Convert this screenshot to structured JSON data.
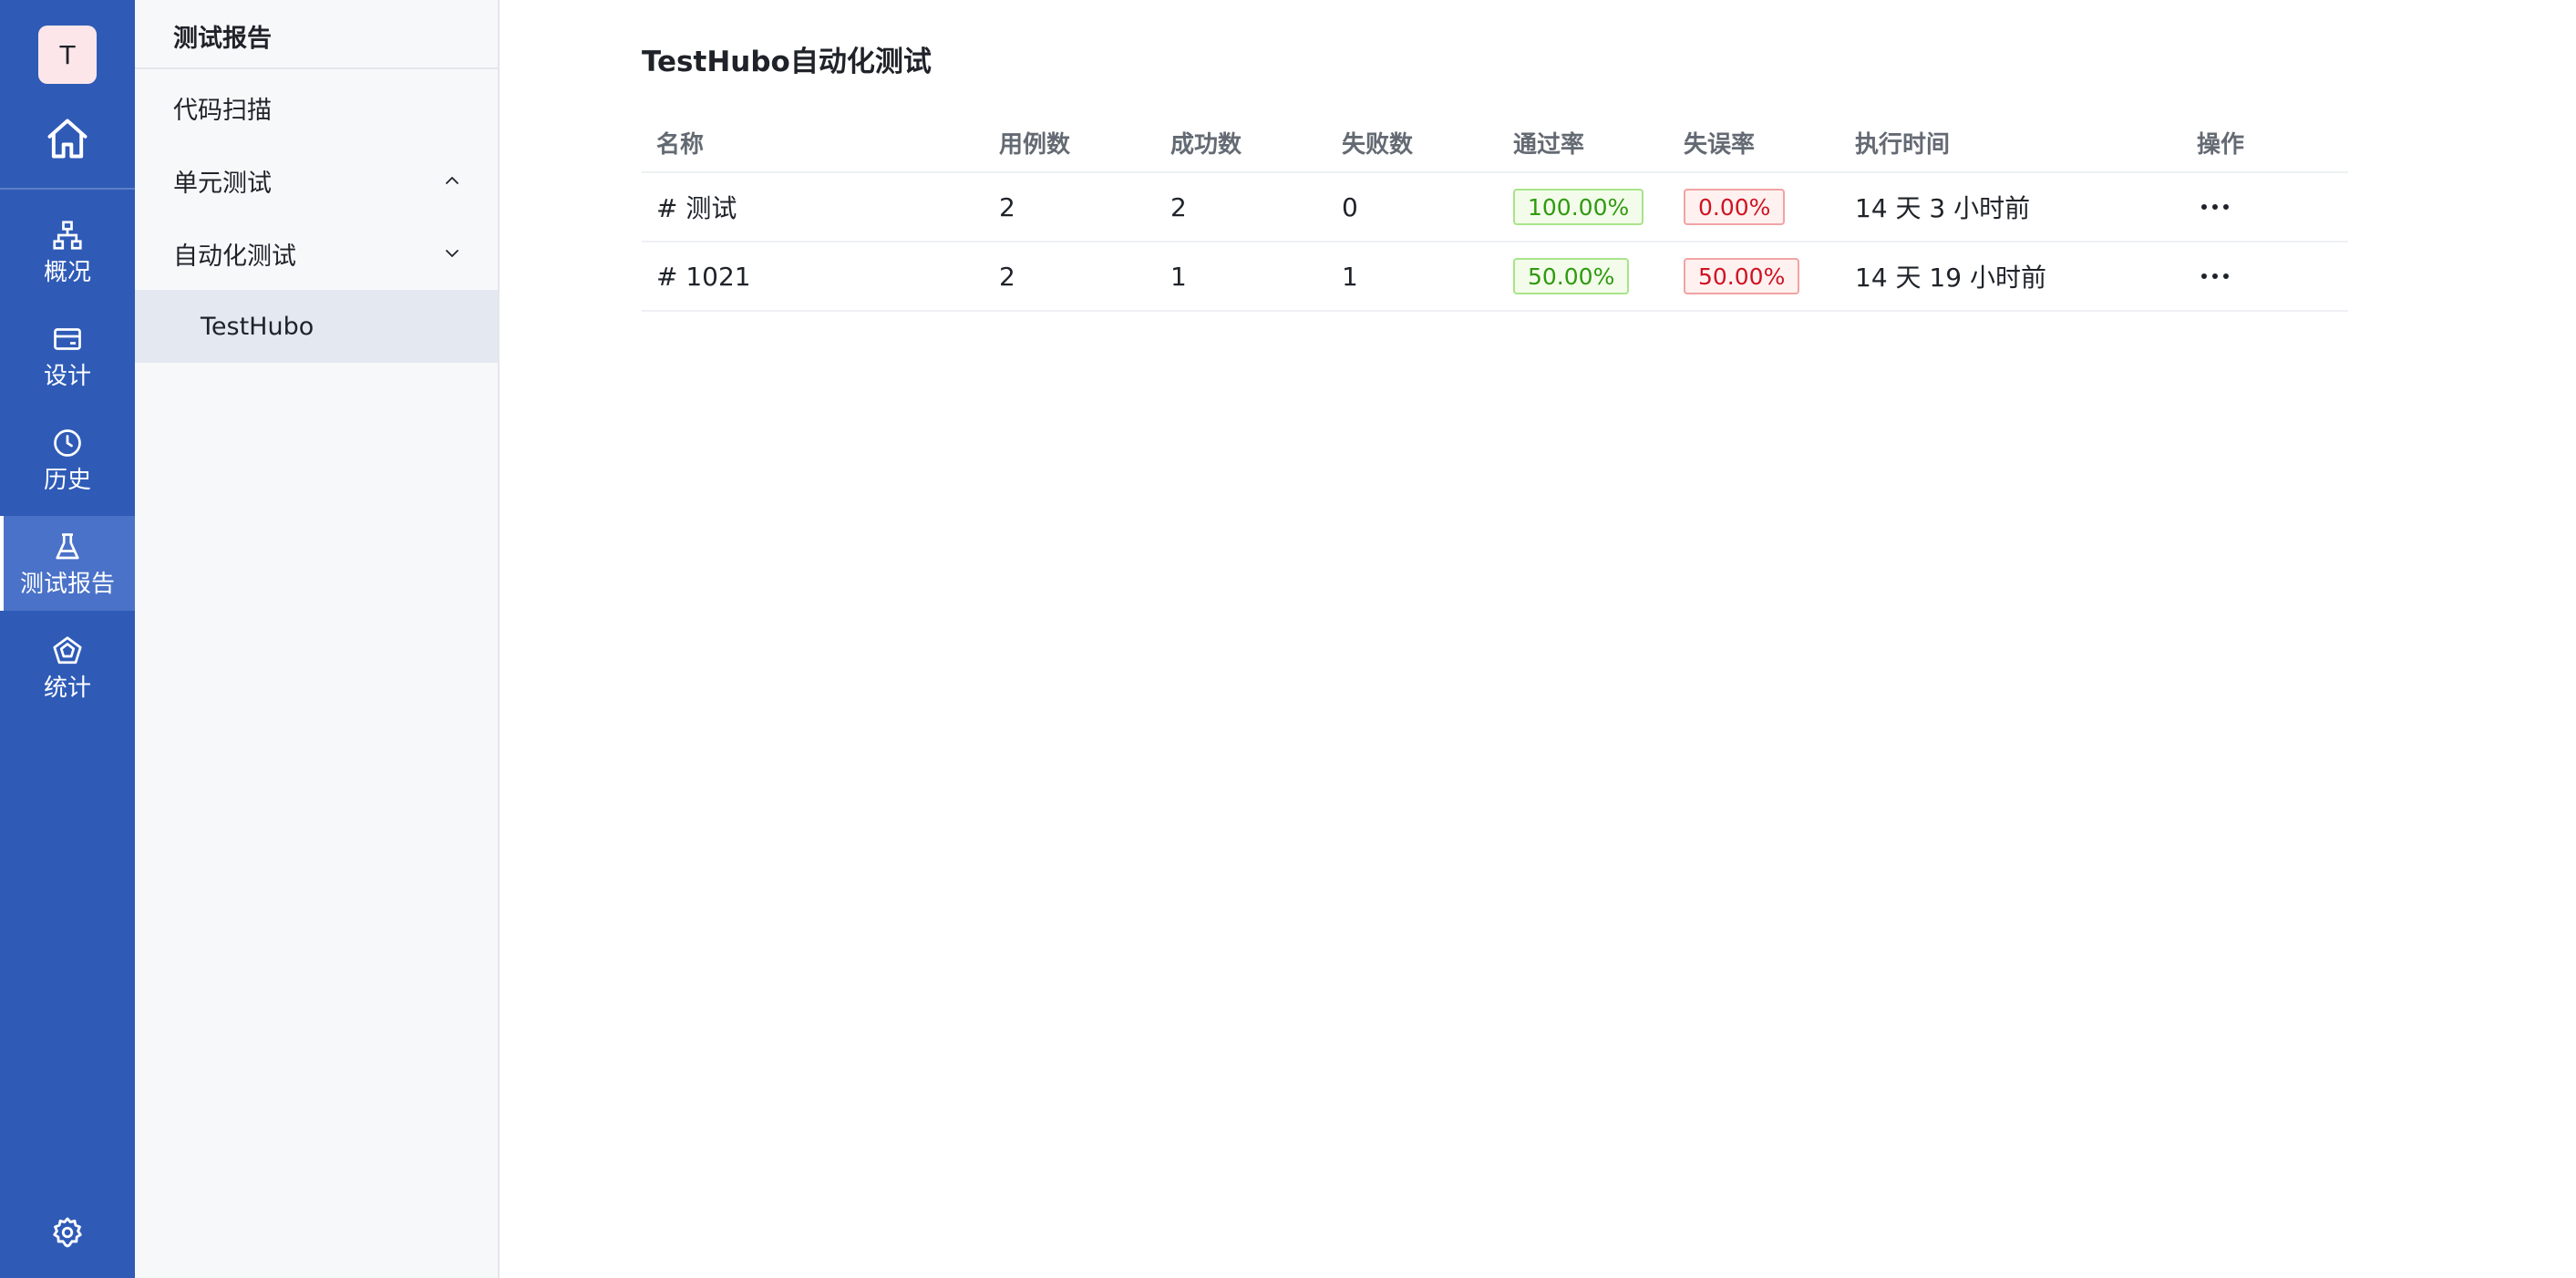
{
  "rail": {
    "avatar_letter": "T",
    "items": [
      {
        "label": "概况",
        "icon": "sitemap-icon"
      },
      {
        "label": "设计",
        "icon": "card-icon"
      },
      {
        "label": "历史",
        "icon": "clock-icon"
      },
      {
        "label": "测试报告",
        "icon": "flask-icon",
        "active": true
      },
      {
        "label": "统计",
        "icon": "radar-icon"
      }
    ],
    "colors": {
      "background": "#2f5bb7",
      "active": "#4a72c8"
    }
  },
  "subnav": {
    "title": "测试报告",
    "items": [
      {
        "label": "代码扫描"
      },
      {
        "label": "单元测试",
        "expanded": true
      },
      {
        "label": "自动化测试",
        "expanded": false
      },
      {
        "label": "TestHubo",
        "selected": true
      }
    ]
  },
  "main": {
    "title": "TestHubo自动化测试",
    "table": {
      "headers": {
        "name": "名称",
        "cases": "用例数",
        "success": "成功数",
        "fail": "失败数",
        "pass_rate": "通过率",
        "error_rate": "失误率",
        "exec_time": "执行时间",
        "ops": "操作"
      },
      "rows": [
        {
          "name": "# 测试",
          "cases": "2",
          "success": "2",
          "fail": "0",
          "pass_rate": "100.00%",
          "error_rate": "0.00%",
          "exec_time": "14 天 3 小时前"
        },
        {
          "name": "# 1021",
          "cases": "2",
          "success": "1",
          "fail": "1",
          "pass_rate": "50.00%",
          "error_rate": "50.00%",
          "exec_time": "14 天 19 小时前"
        }
      ]
    }
  }
}
